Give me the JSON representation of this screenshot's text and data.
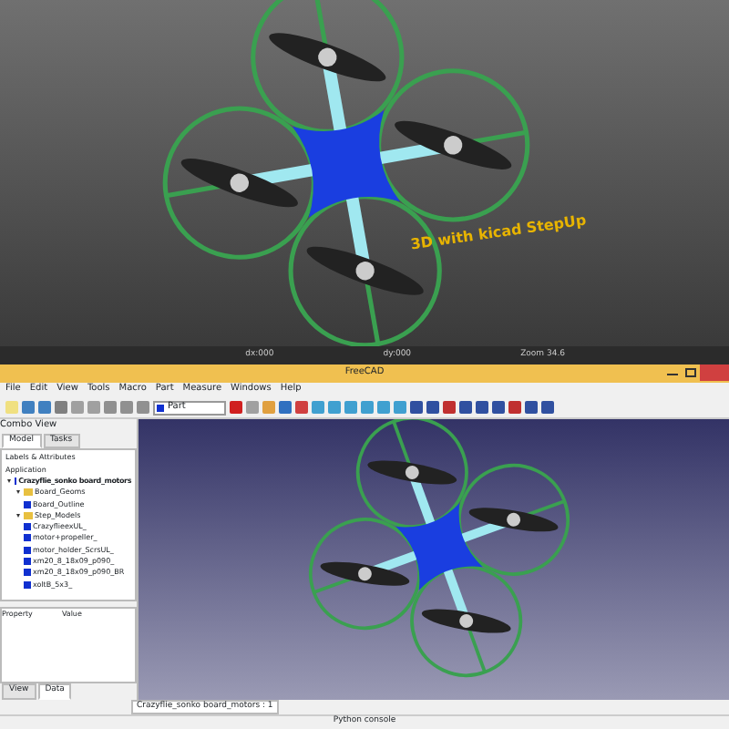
{
  "render": {
    "caption": "3D with kicad StepUp",
    "readouts": [
      "dx:000",
      "dy:000",
      "Zoom 34.6"
    ]
  },
  "window": {
    "title": "FreeCAD"
  },
  "menu": [
    "File",
    "Edit",
    "View",
    "Tools",
    "Macro",
    "Part",
    "Measure",
    "Windows",
    "Help"
  ],
  "toolbar": {
    "workbench": "Part"
  },
  "combo_view": {
    "title": "Combo View",
    "tabs": [
      {
        "label": "Model",
        "selected": true
      },
      {
        "label": "Tasks",
        "selected": false
      }
    ],
    "header": "Labels & Attributes",
    "root": "Application",
    "tree": [
      {
        "label": "Crazyflie_sonko board_motors",
        "expanded": true,
        "children": [
          {
            "label": "Board_Geoms",
            "expanded": true,
            "children": [
              {
                "label": "Board_Outline"
              }
            ]
          },
          {
            "label": "Step_Models",
            "expanded": true,
            "children": [
              {
                "label": "CrazyflieexUL_"
              },
              {
                "label": "motor+propeller_"
              },
              {
                "label": "motor_holder_ScrsUL_"
              },
              {
                "label": "xm20_8_18x09_p090_"
              },
              {
                "label": "xm20_8_18x09_p090_BR"
              },
              {
                "label": "xoltB_5x3_"
              }
            ]
          }
        ]
      }
    ],
    "property_columns": [
      "Property",
      "Value"
    ],
    "bottom_tabs": [
      {
        "label": "View",
        "selected": false
      },
      {
        "label": "Data",
        "selected": true
      }
    ]
  },
  "document_tabs": [
    {
      "label": "Crazyflie_sonko board_motors : 1",
      "selected": true
    }
  ],
  "status_bar": {
    "panel": "Python console"
  }
}
